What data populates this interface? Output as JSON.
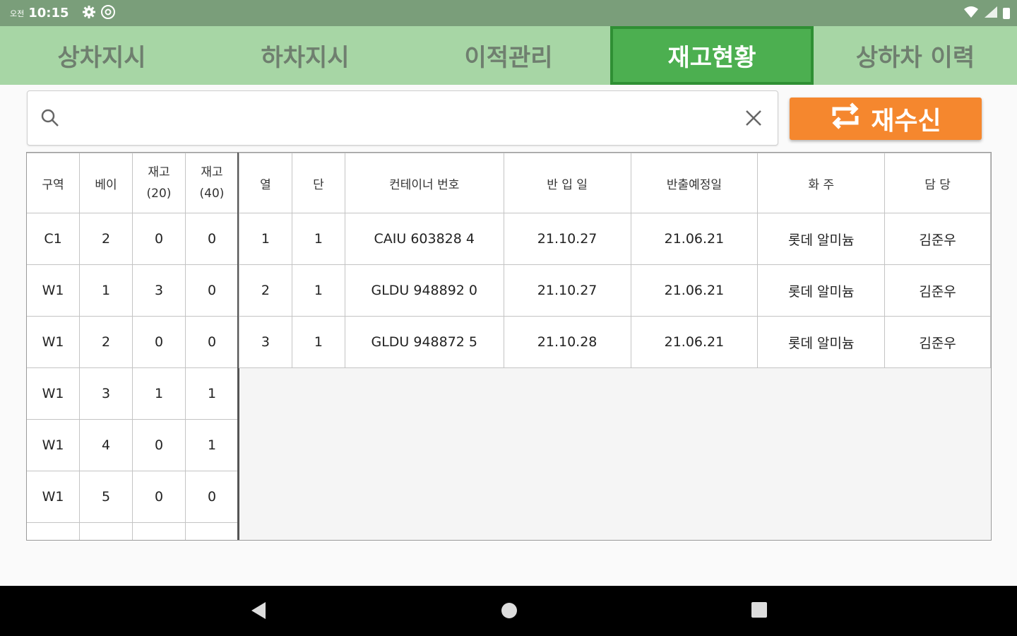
{
  "status_bar": {
    "ampm": "오전",
    "time": "10:15",
    "icons": [
      "gear-icon",
      "at-sign-icon",
      "wifi-icon",
      "cell-signal-icon",
      "battery-icon"
    ]
  },
  "tabs": [
    {
      "label": "상차지시",
      "active": false
    },
    {
      "label": "하차지시",
      "active": false
    },
    {
      "label": "이적관리",
      "active": false
    },
    {
      "label": "재고현황",
      "active": true
    },
    {
      "label": "상하차 이력",
      "active": false
    }
  ],
  "search": {
    "value": "",
    "placeholder": ""
  },
  "refresh_button": {
    "label": "재수신",
    "icon": "repeat-icon"
  },
  "summary_table": {
    "headers": [
      "구역",
      "베이",
      "재고\n(20)",
      "재고\n(40)"
    ],
    "rows": [
      [
        "C1",
        "2",
        "0",
        "0"
      ],
      [
        "W1",
        "1",
        "3",
        "0"
      ],
      [
        "W1",
        "2",
        "0",
        "0"
      ],
      [
        "W1",
        "3",
        "1",
        "1"
      ],
      [
        "W1",
        "4",
        "0",
        "1"
      ],
      [
        "W1",
        "5",
        "0",
        "0"
      ]
    ]
  },
  "detail_table": {
    "headers": [
      "열",
      "단",
      "컨테이너 번호",
      "반 입 일",
      "반출예정일",
      "화 주",
      "담 당"
    ],
    "rows": [
      [
        "1",
        "1",
        "CAIU 603828 4",
        "21.10.27",
        "21.06.21",
        "롯데 알미늄",
        "김준우"
      ],
      [
        "2",
        "1",
        "GLDU 948892 0",
        "21.10.27",
        "21.06.21",
        "롯데 알미늄",
        "김준우"
      ],
      [
        "3",
        "1",
        "GLDU 948872 5",
        "21.10.28",
        "21.06.21",
        "롯데 알미늄",
        "김준우"
      ]
    ]
  },
  "colors": {
    "status_bar": "#7a9e7a",
    "tab_bar": "#a7d6a5",
    "tab_active": "#4caf50",
    "refresh_button": "#f5872e"
  }
}
